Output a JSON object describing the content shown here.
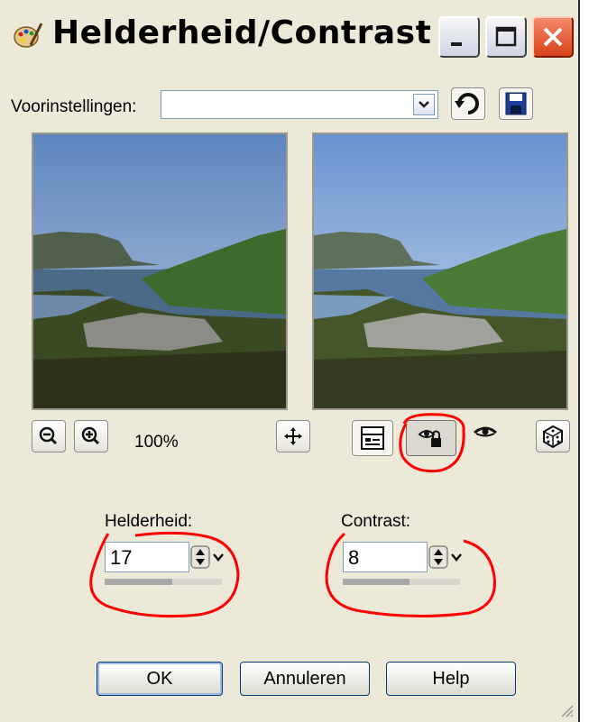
{
  "window": {
    "title": "Helderheid/Contrast"
  },
  "presets": {
    "label": "Voorinstellingen:",
    "value": ""
  },
  "zoom": {
    "level": "100%"
  },
  "fields": {
    "brightness": {
      "label": "Helderheid:",
      "value": "17",
      "slider_fraction": 0.58
    },
    "contrast": {
      "label": "Contrast:",
      "value": "8",
      "slider_fraction": 0.57
    }
  },
  "buttons": {
    "ok": "OK",
    "cancel": "Annuleren",
    "help": "Help"
  },
  "colors": {
    "annotation": "#ff0000",
    "dialog_bg": "#ece9d8",
    "close_button": "#d9421a"
  },
  "icons": {
    "app": "paint-palette-icon",
    "zoom_out": "zoom-out-icon",
    "zoom_in": "zoom-in-icon",
    "pan": "move-arrows-icon",
    "reset": "reset-arrow-icon",
    "save": "floppy-disk-icon",
    "proof": "proof-toggle-icon",
    "auto_proof": "auto-proof-lock-icon",
    "eye": "eye-preview-icon",
    "randomize": "dice-icon"
  }
}
